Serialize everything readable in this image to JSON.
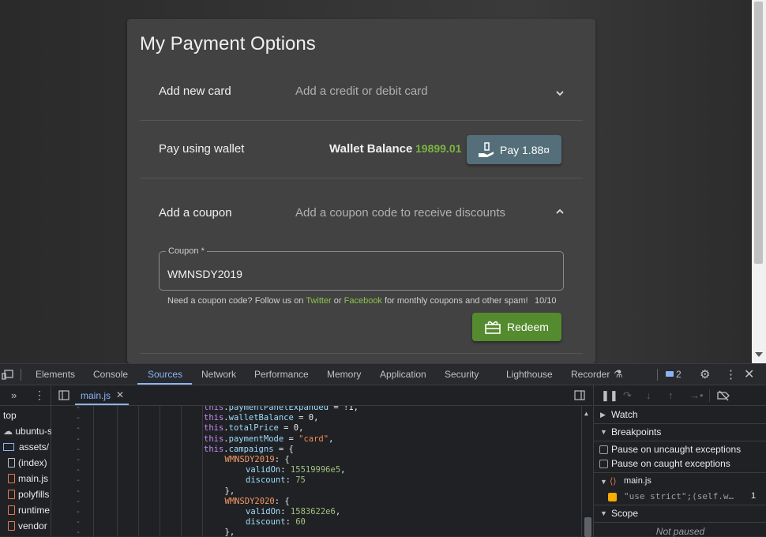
{
  "page": {
    "title": "My Payment Options",
    "add_card": {
      "label": "Add new card",
      "desc": "Add a credit or debit card"
    },
    "wallet": {
      "label": "Pay using wallet",
      "balance_label": "Wallet Balance",
      "balance_value": "19899.01",
      "pay_label": "Pay 1.88¤"
    },
    "coupon": {
      "label": "Add a coupon",
      "desc": "Add a coupon code to receive discounts",
      "field_label": "Coupon *",
      "field_value": "WMNSDY2019",
      "hint_prefix": "Need a coupon code? Follow us on",
      "twitter": "Twitter",
      "or": "or",
      "facebook": "Facebook",
      "hint_suffix": "for monthly coupons and other spam!",
      "counter": "10/10",
      "redeem_label": "Redeem"
    }
  },
  "devtools": {
    "tabs": [
      "Elements",
      "Console",
      "Sources",
      "Network",
      "Performance",
      "Memory",
      "Application",
      "Security",
      "Lighthouse",
      "Recorder"
    ],
    "active_tab": "Sources",
    "issues_count": "2",
    "open_file": "main.js",
    "navigator": [
      "top",
      "ubuntu-se",
      "assets/",
      "(index)",
      "main.js",
      "polyfills",
      "runtime",
      "vendor"
    ],
    "gutter_marker": "-",
    "code_lines": [
      {
        "indent": 0,
        "parts": [
          [
            "kw",
            "this"
          ],
          [
            "obj",
            "."
          ],
          [
            "prop",
            "paymentPanelExpanded"
          ],
          [
            "obj",
            " = !1,"
          ]
        ]
      },
      {
        "indent": 0,
        "parts": [
          [
            "kw",
            "this"
          ],
          [
            "obj",
            "."
          ],
          [
            "prop",
            "walletBalance"
          ],
          [
            "obj",
            " = 0,"
          ]
        ]
      },
      {
        "indent": 0,
        "parts": [
          [
            "kw",
            "this"
          ],
          [
            "obj",
            "."
          ],
          [
            "prop",
            "totalPrice"
          ],
          [
            "obj",
            " = 0,"
          ]
        ]
      },
      {
        "indent": 0,
        "parts": [
          [
            "kw",
            "this"
          ],
          [
            "obj",
            "."
          ],
          [
            "prop",
            "paymentMode"
          ],
          [
            "obj",
            " = "
          ],
          [
            "str",
            "\"card\""
          ],
          [
            "obj",
            ","
          ]
        ]
      },
      {
        "indent": 0,
        "parts": [
          [
            "kw",
            "this"
          ],
          [
            "obj",
            "."
          ],
          [
            "prop",
            "campaigns"
          ],
          [
            "obj",
            " = {"
          ]
        ]
      },
      {
        "indent": 1,
        "parts": [
          [
            "key",
            "WMNSDY2019"
          ],
          [
            "obj",
            ": {"
          ]
        ]
      },
      {
        "indent": 2,
        "parts": [
          [
            "prop",
            "validOn"
          ],
          [
            "obj",
            ": "
          ],
          [
            "num",
            "15519996e5"
          ],
          [
            "obj",
            ","
          ]
        ]
      },
      {
        "indent": 2,
        "parts": [
          [
            "prop",
            "discount"
          ],
          [
            "obj",
            ": "
          ],
          [
            "num",
            "75"
          ]
        ]
      },
      {
        "indent": 1,
        "parts": [
          [
            "obj",
            "},"
          ]
        ]
      },
      {
        "indent": 1,
        "parts": [
          [
            "key",
            "WMNSDY2020"
          ],
          [
            "obj",
            ": {"
          ]
        ]
      },
      {
        "indent": 2,
        "parts": [
          [
            "prop",
            "validOn"
          ],
          [
            "obj",
            ": "
          ],
          [
            "num",
            "1583622e6"
          ],
          [
            "obj",
            ","
          ]
        ]
      },
      {
        "indent": 2,
        "parts": [
          [
            "prop",
            "discount"
          ],
          [
            "obj",
            ": "
          ],
          [
            "num",
            "60"
          ]
        ]
      },
      {
        "indent": 1,
        "parts": [
          [
            "obj",
            "},"
          ]
        ]
      }
    ],
    "sidebar": {
      "watch": "Watch",
      "breakpoints": "Breakpoints",
      "pause_uncaught": "Pause on uncaught exceptions",
      "pause_caught": "Pause on caught exceptions",
      "bp_file": "main.js",
      "bp_code": "\"use strict\";(self.w…",
      "bp_line": "1",
      "scope": "Scope",
      "not_paused": "Not paused"
    }
  }
}
